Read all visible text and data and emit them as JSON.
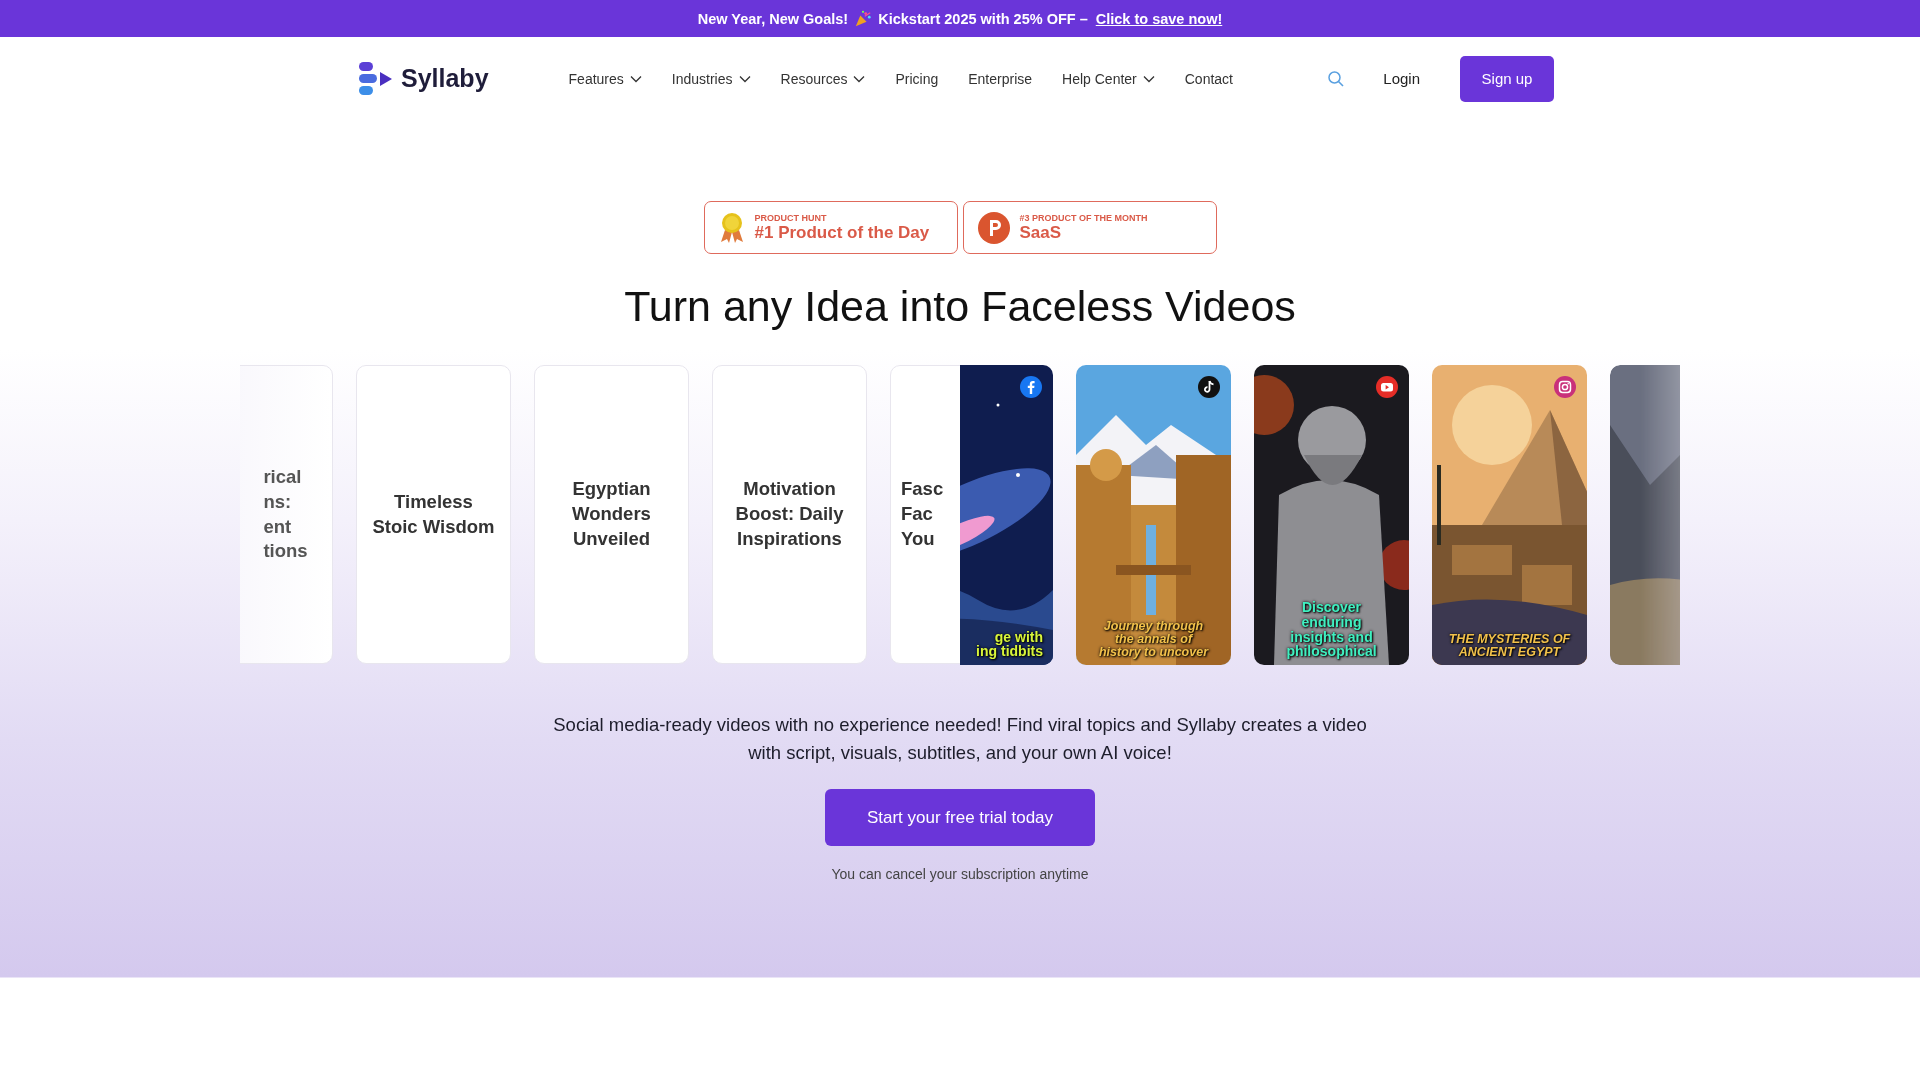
{
  "promo_banner": {
    "text_before": "New Year, New Goals!",
    "text_after": "Kickstart 2025 with 25% OFF –",
    "link": "Click to save now!"
  },
  "header": {
    "logo": "Syllaby",
    "nav": [
      {
        "label": "Features",
        "has_menu": true
      },
      {
        "label": "Industries",
        "has_menu": true
      },
      {
        "label": "Resources",
        "has_menu": true
      },
      {
        "label": "Pricing",
        "has_menu": false
      },
      {
        "label": "Enterprise",
        "has_menu": false
      },
      {
        "label": "Help Center",
        "has_menu": true
      },
      {
        "label": "Contact",
        "has_menu": false
      }
    ],
    "login": "Login",
    "signup": "Sign up"
  },
  "awards": [
    {
      "kind": "medal",
      "eyebrow": "PRODUCT HUNT",
      "title": "#1 Product of the Day"
    },
    {
      "kind": "p-logo",
      "eyebrow": "#3 PRODUCT OF THE MONTH",
      "title": "SaaS"
    }
  ],
  "headline": "Turn any Idea into Faceless Videos",
  "topic_cards": [
    {
      "title": "rical\nns:\nent\ntions"
    },
    {
      "title": "Timeless\nStoic Wisdom"
    },
    {
      "title": "Egyptian\nWonders\nUnveiled"
    },
    {
      "title": "Motivation\nBoost: Daily\nInspirations"
    },
    {
      "title": "Fasc\nFac\nYou"
    }
  ],
  "video_cards": [
    {
      "kind": "picture",
      "caption": "ge with\ning tidbits"
    },
    {
      "kind": "picture",
      "caption": "Journey through\nthe annals of\nhistory to uncover"
    },
    {
      "kind": "picture",
      "caption": "Discover\nenduring\ninsights and\nphilosophical"
    },
    {
      "kind": "picture",
      "caption": "THE MYSTERIES OF\nANCIENT EGYPT"
    },
    {
      "kind": "picture"
    }
  ],
  "description": "Social media-ready videos with no experience needed! Find viral topics and Syllaby creates a video with script, visuals, subtitles, and your own AI voice!",
  "cta": "Start your free trial today",
  "cta_note": "You can cancel your subscription anytime"
}
